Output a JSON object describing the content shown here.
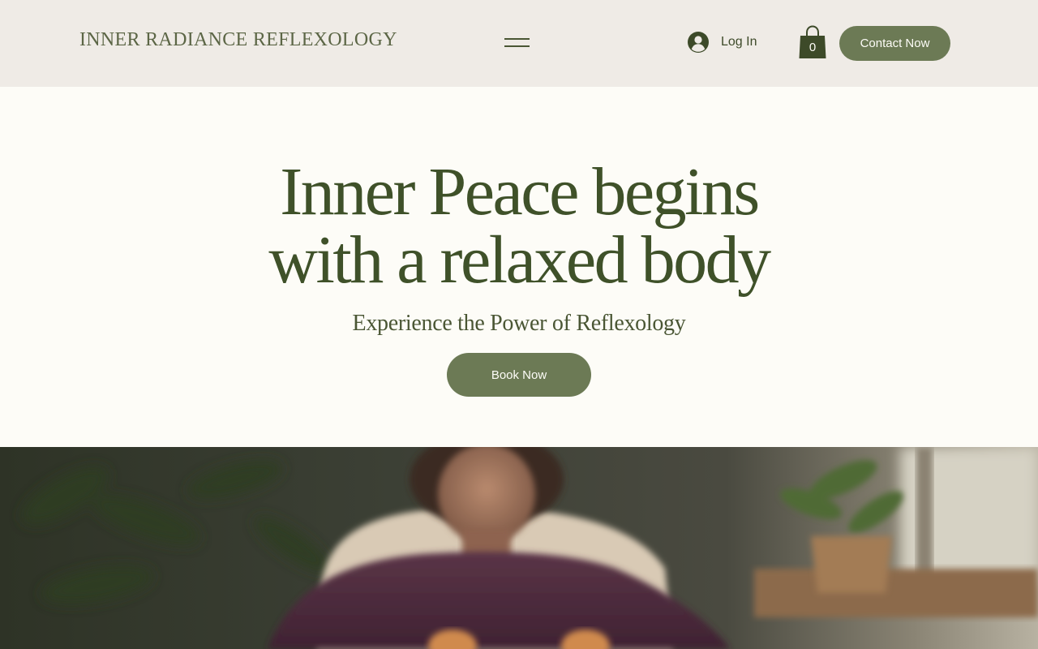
{
  "header": {
    "logo_text": "INNER RADIANCE REFLEXOLOGY",
    "menu_icon": "hamburger-menu-icon",
    "login_icon": "user-avatar-icon",
    "login_label": "Log In",
    "cart_icon": "shopping-bag-icon",
    "cart_count": "0",
    "contact_label": "Contact Now"
  },
  "hero": {
    "title_line1": "Inner Peace begins",
    "title_line2": "with a relaxed body",
    "subtitle": "Experience the Power of Reflexology",
    "book_label": "Book Now"
  },
  "colors": {
    "header_bg": "#efebe6",
    "page_bg": "#fdfcf7",
    "accent": "#6c7a55",
    "heading": "#3f5129"
  }
}
